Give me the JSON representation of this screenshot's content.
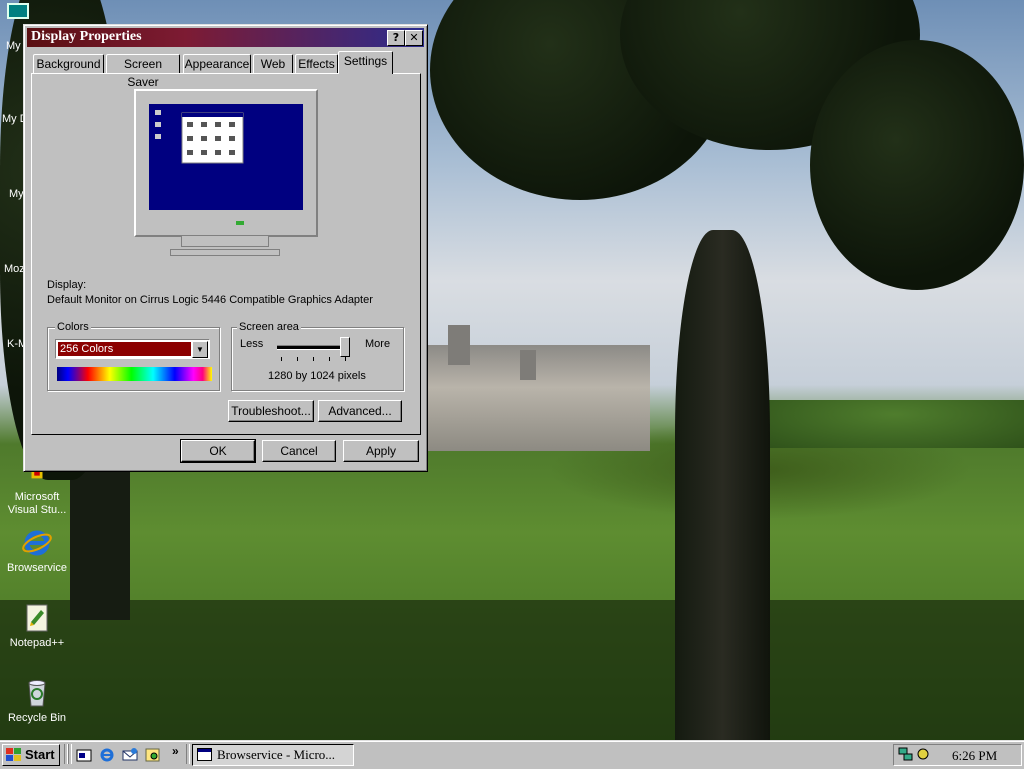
{
  "dialog": {
    "title": "Display Properties",
    "help_label": "?",
    "close_label": "✕",
    "tabs": [
      {
        "label": "Background"
      },
      {
        "label": "Screen Saver"
      },
      {
        "label": "Appearance"
      },
      {
        "label": "Web"
      },
      {
        "label": "Effects"
      },
      {
        "label": "Settings"
      }
    ],
    "active_tab": "Settings",
    "display_label": "Display:",
    "display_value": "Default Monitor on Cirrus Logic 5446 Compatible Graphics Adapter",
    "colors": {
      "group_label": "Colors",
      "selected": "256 Colors"
    },
    "screen_area": {
      "group_label": "Screen area",
      "less_label": "Less",
      "more_label": "More",
      "resolution": "1280 by 1024 pixels",
      "slider_level": 1.0
    },
    "troubleshoot_label": "Troubleshoot...",
    "advanced_label": "Advanced...",
    "ok_label": "OK",
    "cancel_label": "Cancel",
    "apply_label": "Apply"
  },
  "desktop": {
    "icons": [
      {
        "label": "My",
        "icon": "computer-icon"
      },
      {
        "label": "My D",
        "icon": "documents-icon"
      },
      {
        "label": "My",
        "icon": "network-icon"
      },
      {
        "label": "Moz",
        "icon": "mozilla-icon"
      },
      {
        "label": "K-M",
        "icon": "media-player-icon"
      },
      {
        "label": "Microsoft Visual Stu...",
        "icon": "visual-studio-icon"
      },
      {
        "label": "Browservice",
        "icon": "internet-explorer-icon"
      },
      {
        "label": "Notepad++",
        "icon": "notepad-icon"
      },
      {
        "label": "Recycle Bin",
        "icon": "recycle-bin-icon"
      }
    ]
  },
  "taskbar": {
    "start_label": "Start",
    "quick_launch": [
      "show-desktop-icon",
      "internet-explorer-icon",
      "outlook-icon",
      "channels-icon"
    ],
    "more_label": "»",
    "task_label": "Browservice - Micro...",
    "clock": "6:26 PM"
  },
  "colors": {
    "title_gradient_start": "#5a0f12",
    "title_gradient_end": "#2b2c8e",
    "selection": "#8b0000",
    "face": "#c0c0c0",
    "preview_screen": "#000080"
  }
}
